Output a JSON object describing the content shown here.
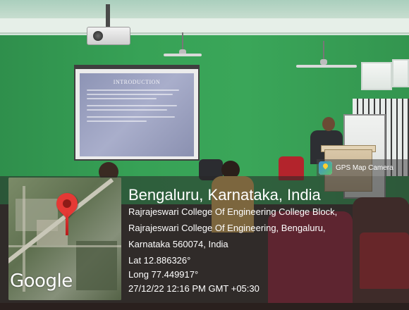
{
  "gps_app": {
    "name": "GPS Map Camera",
    "icon": "gps-map-camera-app-icon"
  },
  "location": {
    "title": "Bengaluru, Karnataka, India",
    "address_line_1": "Rajrajeswari College Of Engineering College Block,",
    "address_line_2": "Rajrajeswari College Of Engineering, Bengaluru,",
    "address_line_3": "Karnataka 560074, India",
    "latitude": "Lat 12.886326°",
    "longitude": "Long 77.449917°",
    "timestamp": "27/12/22 12:16 PM GMT +05:30"
  },
  "map": {
    "brand": "Google",
    "pin_color": "#e53935",
    "pin_icon": "map-pin-icon"
  },
  "slide": {
    "title": "INTRODUCTION"
  }
}
